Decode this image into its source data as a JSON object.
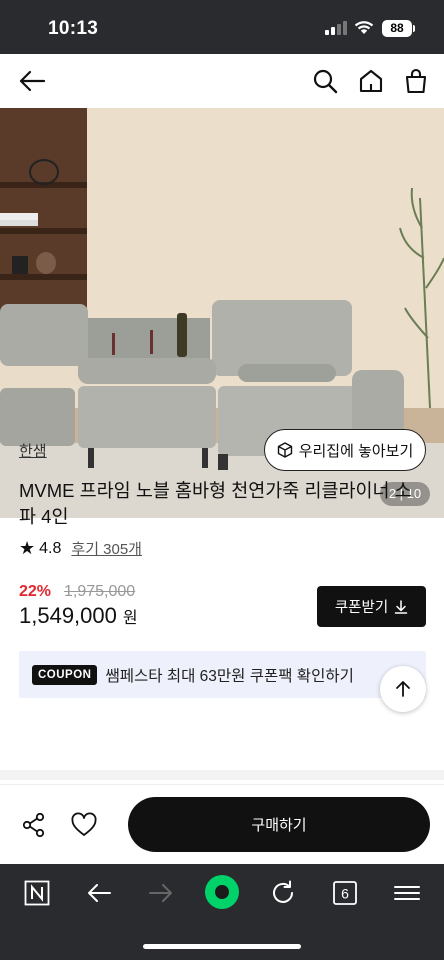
{
  "status": {
    "time": "10:13",
    "battery": "88"
  },
  "hero": {
    "pager": "2 | 10"
  },
  "product": {
    "brand": "한샘",
    "ar_button": "우리집에 놓아보기",
    "title": "MVME 프라임 노블 홈바형 천연가죽 리클라이너 소파 4인",
    "rating": "4.8",
    "reviews": "후기 305개",
    "discount": "22%",
    "original_price": "1,975,000",
    "price": "1,549,000",
    "currency": "원",
    "coupon_button": "쿠폰받기"
  },
  "banner": {
    "tag": "COUPON",
    "text": "쌤페스타 최대 63만원 쿠폰팩 확인하기"
  },
  "buybar": {
    "buy_label": "구매하기"
  },
  "toolbar": {
    "tab_count": "6",
    "accent": "#00d26a"
  },
  "icons": [
    "back-arrow-icon",
    "search-icon",
    "home-icon",
    "cart-bag-icon",
    "ar-cube-icon",
    "star-icon",
    "download-icon",
    "arrow-up-icon",
    "share-icon",
    "heart-icon",
    "naver-n-icon",
    "forward-arrow-icon",
    "green-dot-icon",
    "refresh-icon",
    "tabs-icon",
    "menu-icon"
  ]
}
